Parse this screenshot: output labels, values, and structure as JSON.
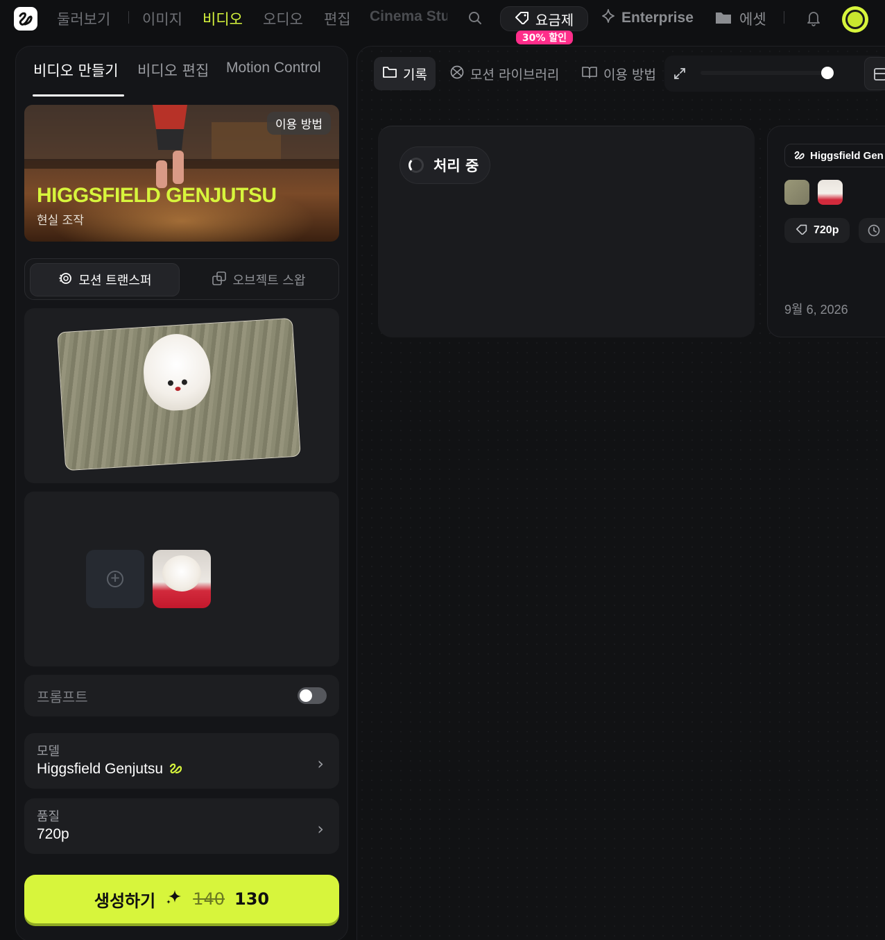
{
  "nav": {
    "links": [
      "둘러보기",
      "이미지",
      "비디오",
      "오디오",
      "편집",
      "Cinema Stu"
    ],
    "active_index": 2,
    "pricing_label": "요금제",
    "discount_badge": "30% 할인",
    "enterprise_label": "Enterprise",
    "assets_label": "에셋",
    "icons": [
      "logo-icon",
      "search-icon",
      "tag-icon",
      "sparkle-icon",
      "folder-icon",
      "bell-icon",
      "avatar"
    ]
  },
  "left": {
    "tabs": [
      "비디오 만들기",
      "비디오 편집",
      "Motion Control"
    ],
    "active_tab": 0,
    "hero": {
      "title": "HIGGSFIELD GENJUTSU",
      "subtitle": "현실 조작",
      "help_label": "이용 방법"
    },
    "modes": [
      "모션 트랜스퍼",
      "오브젝트 스왑"
    ],
    "active_mode": 0,
    "prompt_label": "프롬프트",
    "prompt_enabled": false,
    "model": {
      "label": "모델",
      "value": "Higgsfield Genjutsu"
    },
    "quality": {
      "label": "품질",
      "value": "720p"
    },
    "generate": {
      "label": "생성하기",
      "old_cost": "140",
      "cost": "130"
    }
  },
  "right": {
    "tabs": [
      "기록",
      "모션 라이브러리",
      "이용 방법"
    ],
    "active_tab": 0,
    "zoom_level": 0.95,
    "job": {
      "status": "처리 중"
    },
    "info": {
      "model_chip": "Higgsfield Gen",
      "resolution": "720p",
      "date": "9월 6, 2026"
    }
  },
  "colors": {
    "accent": "#d7f53c",
    "badge": "#ff2d8a",
    "background": "#0f1012",
    "card": "#1d1e21"
  }
}
